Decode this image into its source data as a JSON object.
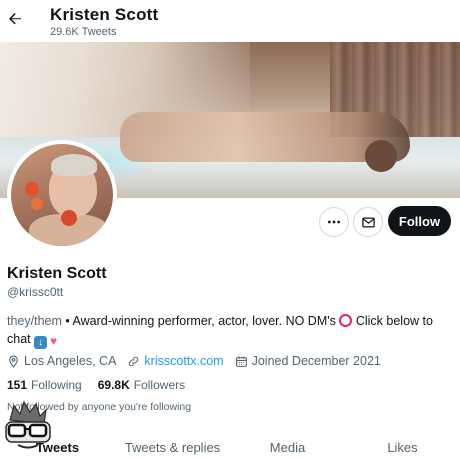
{
  "header": {
    "title": "Kristen Scott",
    "tweet_count": "29.6K Tweets"
  },
  "profile": {
    "name": "Kristen Scott",
    "handle": "@krissc0tt",
    "follow_label": "Follow"
  },
  "bio": {
    "pronouns": "they/them",
    "text": " • Award-winning performer, actor, lover. NO DM's ",
    "text_after": " Click below to chat "
  },
  "meta": {
    "location": "Los Angeles, CA",
    "link": "krisscottx.com",
    "joined": "Joined December 2021"
  },
  "stats": {
    "following_count": "151",
    "following_label": "Following",
    "followers_count": "69.8K",
    "followers_label": "Followers"
  },
  "not_followed": "Not followed by anyone you're following",
  "tabs": [
    {
      "label": "Tweets"
    },
    {
      "label": "Tweets & replies"
    },
    {
      "label": "Media"
    },
    {
      "label": "Likes"
    }
  ],
  "icons": {
    "back": "arrow-left-icon",
    "more": "more-dots-icon",
    "message": "envelope-icon",
    "location": "location-pin-icon",
    "link": "link-icon",
    "calendar": "calendar-icon"
  },
  "colors": {
    "accent": "#1d9bf0",
    "follow_bg": "#0f1419",
    "muted": "#536471"
  }
}
